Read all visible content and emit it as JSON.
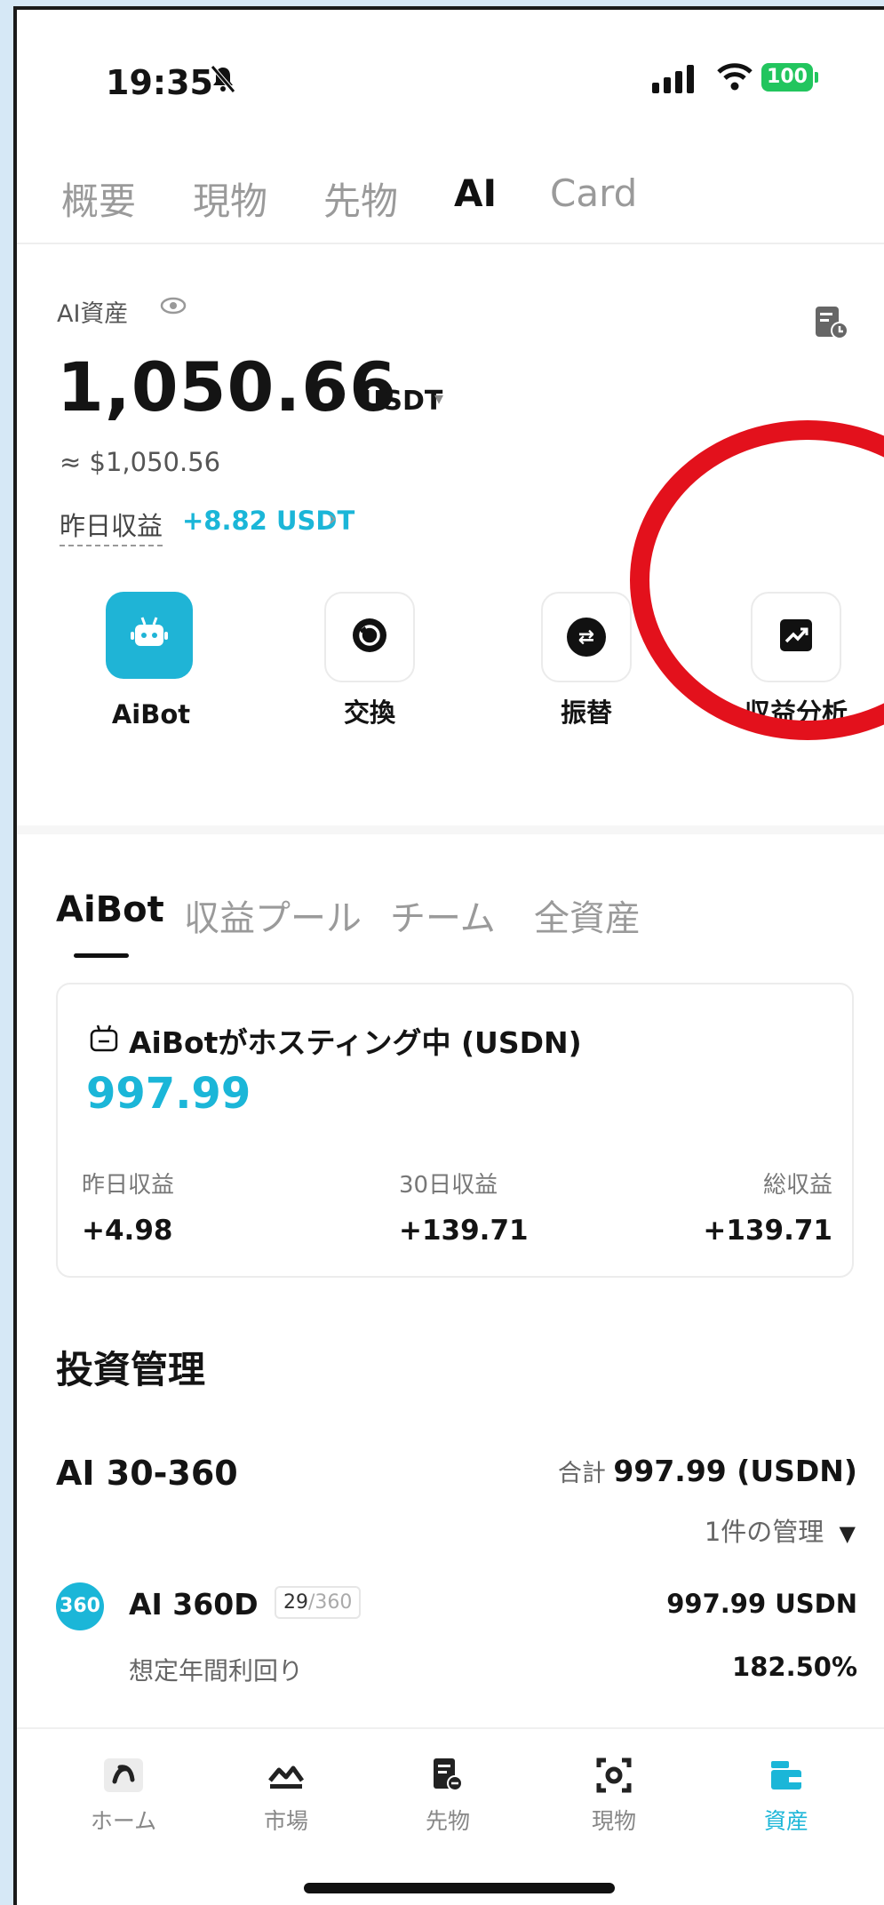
{
  "status_bar": {
    "time": "19:35",
    "battery": "100"
  },
  "top_tabs": [
    {
      "label": "概要"
    },
    {
      "label": "現物"
    },
    {
      "label": "先物"
    },
    {
      "label": "AI"
    },
    {
      "label": "Card"
    }
  ],
  "asset": {
    "label": "AI資産",
    "amount": "1,050.66",
    "unit": "USDT",
    "approx": "≈ $1,050.56",
    "yesterday_label": "昨日収益",
    "yesterday_value": "+8.82 USDT"
  },
  "actions": [
    {
      "label": "AiBot"
    },
    {
      "label": "交換"
    },
    {
      "label": "振替"
    },
    {
      "label": "収益分析"
    }
  ],
  "sub_tabs": [
    {
      "label": "AiBot"
    },
    {
      "label": "収益プール"
    },
    {
      "label": "チーム"
    },
    {
      "label": "全資産"
    }
  ],
  "hosting_card": {
    "title": "AiBotがホスティング中 (USDN)",
    "amount": "997.99",
    "stats": [
      {
        "label": "昨日収益",
        "value": "+4.98"
      },
      {
        "label": "30日収益",
        "value": "+139.71"
      },
      {
        "label": "総収益",
        "value": "+139.71"
      }
    ]
  },
  "management": {
    "title": "投資管理",
    "plan_name": "AI 30-360",
    "total_label": "合計",
    "total_value": "997.99 (USDN)",
    "manage_label": "1件の管理",
    "item": {
      "badge": "360",
      "name": "AI 360D",
      "progress_current": "29",
      "progress_total": "/360",
      "amount": "997.99 USDN",
      "yield_label": "想定年間利回り",
      "yield_value": "182.50%"
    }
  },
  "bottom_nav": [
    {
      "label": "ホーム"
    },
    {
      "label": "市場"
    },
    {
      "label": "先物"
    },
    {
      "label": "現物"
    },
    {
      "label": "資産"
    }
  ],
  "colors": {
    "accent": "#1bb6d8",
    "highlight_ring": "#e3111c"
  }
}
